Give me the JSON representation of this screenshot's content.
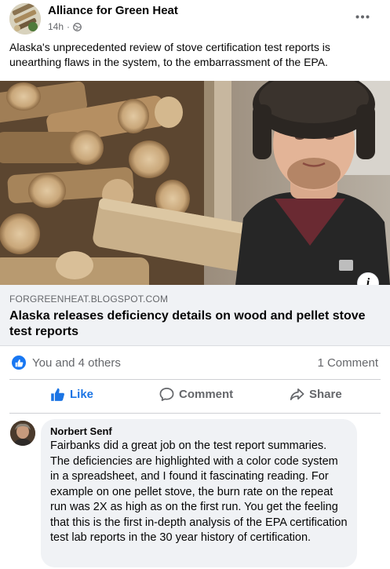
{
  "post": {
    "page_name": "Alliance for Green Heat",
    "timestamp": "14h",
    "separator": "·",
    "audience_icon": "globe-icon",
    "more_icon": "more-options-icon",
    "text": "Alaska's unprecedented review of stove certification test reports is unearthing flaws in the system, to the embarrassment of the EPA."
  },
  "link_preview": {
    "image": "photo of a man in a fur hat standing next to a stack of firewood",
    "info_label": "i",
    "domain": "FORGREENHEAT.BLOGSPOT.COM",
    "title": "Alaska releases deficiency details on wood and pellet stove test reports"
  },
  "reactions": {
    "icon": "like-reaction-icon",
    "summary": "You and 4 others",
    "comments_count": "1 Comment"
  },
  "actions": {
    "like_label": "Like",
    "comment_label": "Comment",
    "share_label": "Share"
  },
  "comment": {
    "author": "Norbert Senf",
    "text": "Fairbanks did a great job on the test report summaries. The deficiencies are highlighted with a color code system in a spreadsheet, and I found it fascinating reading. For example on one pellet stove, the burn rate on the repeat run was 2X as high as on the first run. You get the feeling that this is the first in-depth analysis of the EPA certification test lab reports in the 30 year history of certification."
  },
  "colors": {
    "accent_blue": "#1b74e4",
    "secondary_text": "#65676b",
    "card_background": "#f0f2f5"
  }
}
